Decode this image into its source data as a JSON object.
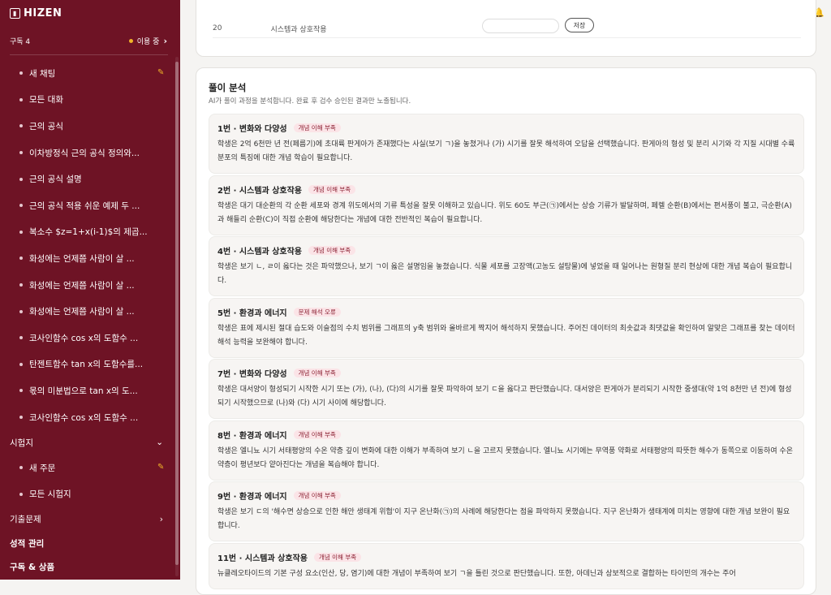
{
  "brand": {
    "logo_text": "HIZEN"
  },
  "sidebar": {
    "subscription_label": "구독 4",
    "status_label": "이용 중",
    "chats": [
      {
        "label": "새 채팅",
        "edit": true
      },
      {
        "label": "모든 대화"
      },
      {
        "label": "근의 공식"
      },
      {
        "label": "이차방정식 근의 공식 정의와..."
      },
      {
        "label": "근의 공식 설명"
      },
      {
        "label": "근의 공식 적용 쉬운 예제 두 ..."
      },
      {
        "label": "복소수 $z=1+x(i-1)$의 제곱..."
      },
      {
        "label": "화성에는 언제쯤 사람이 살 ..."
      },
      {
        "label": "화성에는 언제쯤 사람이 살 ..."
      },
      {
        "label": "화성에는 언제쯤 사람이 살 ..."
      },
      {
        "label": "코사인함수 cos x의 도함수 ..."
      },
      {
        "label": "탄젠트함수 tan x의 도함수를..."
      },
      {
        "label": "몫의 미분법으로 tan x의 도..."
      },
      {
        "label": "코사인함수 cos x의 도함수 ..."
      }
    ],
    "exam_section": "시험지",
    "exam_items": [
      {
        "label": "새 주문",
        "edit": true
      },
      {
        "label": "모든 시험지"
      }
    ],
    "past_section": "기출문제",
    "grade_section": "성적 관리",
    "plan_section": "구독 & 상품"
  },
  "top_row": {
    "number": "20",
    "text": "시스템과 상호작용",
    "button": "저장"
  },
  "analysis": {
    "title": "풀이 분석",
    "subtitle": "AI가 풀이 과정을 분석합니다. 완료 후 검수 승인된 결과만 노출됩니다.",
    "items": [
      {
        "title": "1번 · 변화와 다양성",
        "tag": "개념 이해 부족",
        "body": "학생은 2억 6천만 년 전(페름기)에 초대륙 판게아가 존재했다는 사실(보기 ㄱ)을 놓쳤거나 (가) 시기를 잘못 해석하여 오답을 선택했습니다. 판게아의 형성 및 분리 시기와 각 지질 시대별 수륙 분포의 특징에 대한 개념 학습이 필요합니다."
      },
      {
        "title": "2번 · 시스템과 상호작용",
        "tag": "개념 이해 부족",
        "body": "학생은 대기 대순환의 각 순환 세포와 경계 위도에서의 기류 특성을 잘못 이해하고 있습니다. 위도 60도 부근(㉠)에서는 상승 기류가 발달하며, 페렐 순환(B)에서는 편서풍이 불고, 극순환(A)과 해들리 순환(C)이 직접 순환에 해당한다는 개념에 대한 전반적인 복습이 필요합니다."
      },
      {
        "title": "4번 · 시스템과 상호작용",
        "tag": "개념 이해 부족",
        "body": "학생은 보기 ㄴ, ㄹ이 옳다는 것은 파악했으나, 보기 ㄱ이 옳은 설명임을 놓쳤습니다. 식물 세포를 고장액(고농도 설탕물)에 넣었을 때 일어나는 원형질 분리 현상에 대한 개념 복습이 필요합니다."
      },
      {
        "title": "5번 · 환경과 에너지",
        "tag": "문제 해석 오류",
        "body": "학생은 표에 제시된 절대 습도와 이슬점의 수치 범위를 그래프의 y축 범위와 올바르게 짝지어 해석하지 못했습니다. 주어진 데이터의 최솟값과 최댓값을 확인하여 알맞은 그래프를 찾는 데이터 해석 능력을 보완해야 합니다."
      },
      {
        "title": "7번 · 변화와 다양성",
        "tag": "개념 이해 부족",
        "body": "학생은 대서양이 형성되기 시작한 시기 또는 (가), (나), (다)의 시기를 잘못 파악하여 보기 ㄷ을 옳다고 판단했습니다. 대서양은 판게아가 분리되기 시작한 중생대(약 1억 8천만 년 전)에 형성되기 시작했으므로 (나)와 (다) 시기 사이에 해당합니다."
      },
      {
        "title": "8번 · 환경과 에너지",
        "tag": "개념 이해 부족",
        "body": "학생은 엘니뇨 시기 서태평양의 수온 약층 깊이 변화에 대한 이해가 부족하여 보기 ㄴ을 고르지 못했습니다. 엘니뇨 시기에는 무역풍 약화로 서태평양의 따뜻한 해수가 동쪽으로 이동하여 수온 약층이 평년보다 얕아진다는 개념을 복습해야 합니다."
      },
      {
        "title": "9번 · 환경과 에너지",
        "tag": "개념 이해 부족",
        "body": "학생은 보기 ㄷ의 '해수면 상승으로 인한 해안 생태계 위협'이 지구 온난화(㉠)의 사례에 해당한다는 점을 파악하지 못했습니다. 지구 온난화가 생태계에 미치는 영향에 대한 개념 보완이 필요합니다."
      },
      {
        "title": "11번 · 시스템과 상호작용",
        "tag": "개념 이해 부족",
        "body": "뉴클레오타이드의 기본 구성 요소(인산, 당, 염기)에 대한 개념이 부족하여 보기 ㄱ을 틀린 것으로 판단했습니다. 또한, 아데닌과 상보적으로 결합하는 타이민의 개수는 주어"
      }
    ]
  }
}
